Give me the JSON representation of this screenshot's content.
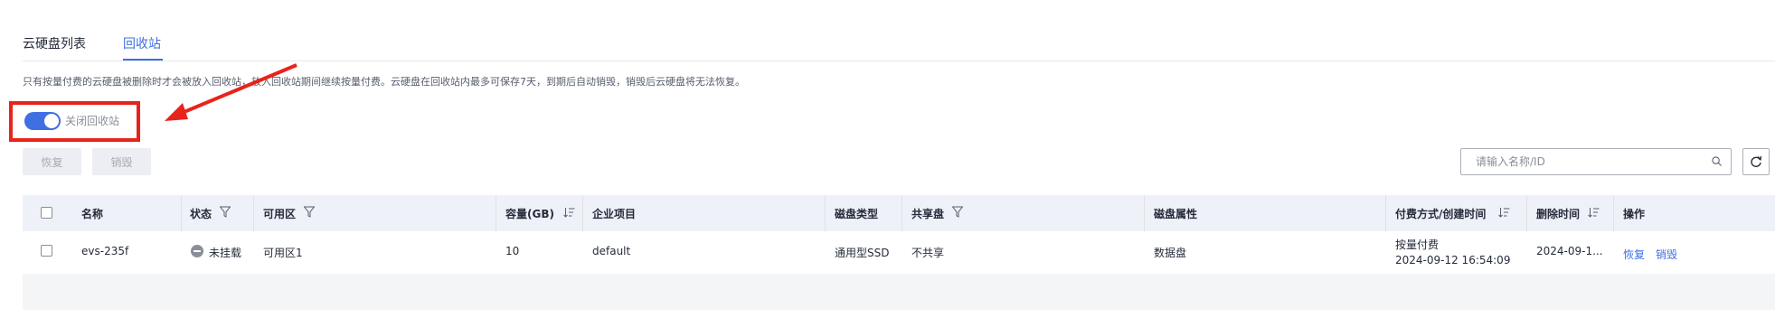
{
  "tabs": [
    {
      "label": "云硬盘列表"
    },
    {
      "label": "回收站"
    }
  ],
  "notice": "只有按量付费的云硬盘被删除时才会被放入回收站，放入回收站期间继续按量付费。云硬盘在回收站内最多可保存7天，到期后自动销毁，销毁后云硬盘将无法恢复。",
  "recycle_toggle": {
    "label": "关闭回收站",
    "on": true
  },
  "toolbar": {
    "restore_label": "恢复",
    "destroy_label": "销毁"
  },
  "search": {
    "placeholder": "请输入名称/ID"
  },
  "table": {
    "columns": [
      "名称",
      "状态",
      "可用区",
      "容量(GB)",
      "企业项目",
      "磁盘类型",
      "共享盘",
      "磁盘属性",
      "付费方式/创建时间",
      "删除时间",
      "操作"
    ],
    "rows": [
      {
        "name": "evs-235f",
        "status": "未挂载",
        "zone": "可用区1",
        "capacity": "10",
        "project": "default",
        "disk_type": "通用型SSD",
        "shared": "不共享",
        "attribute": "数据盘",
        "billing": "按量付费",
        "created": "2024-09-12 16:54:09",
        "deleted": "2024-09-1...",
        "actions": [
          "恢复",
          "销毁"
        ]
      }
    ]
  },
  "colors": {
    "accent": "#3f6fe0",
    "annotation": "#e8231b"
  }
}
